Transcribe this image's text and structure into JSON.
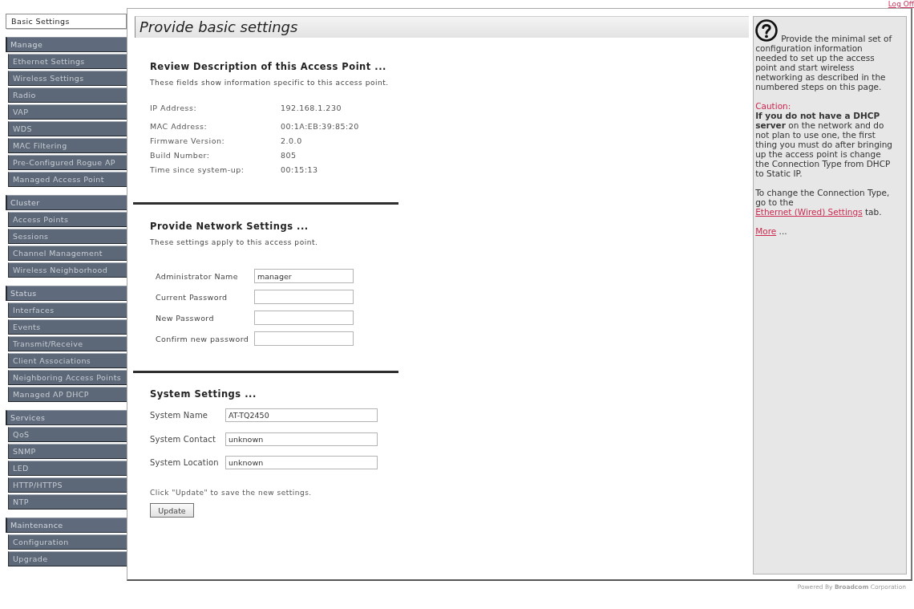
{
  "header": {
    "logoff_link": "Log Off"
  },
  "sidebar": {
    "home": {
      "label": "Basic Settings",
      "selected": true
    },
    "groups": [
      {
        "label": "Manage",
        "items": [
          {
            "label": "Ethernet Settings",
            "selected": false
          },
          {
            "label": "Wireless Settings",
            "selected": false
          },
          {
            "label": "Radio",
            "selected": false
          },
          {
            "label": "VAP",
            "selected": false
          },
          {
            "label": "WDS",
            "selected": false
          },
          {
            "label": "MAC Filtering",
            "selected": false
          },
          {
            "label": "Pre-Configured Rogue AP",
            "selected": false
          },
          {
            "label": "Managed Access Point",
            "selected": false
          }
        ]
      },
      {
        "label": "Cluster",
        "items": [
          {
            "label": "Access Points",
            "selected": false
          },
          {
            "label": "Sessions",
            "selected": false
          },
          {
            "label": "Channel Management",
            "selected": false
          },
          {
            "label": "Wireless Neighborhood",
            "selected": false
          }
        ]
      },
      {
        "label": "Status",
        "items": [
          {
            "label": "Interfaces",
            "selected": false
          },
          {
            "label": "Events",
            "selected": false
          },
          {
            "label": "Transmit/Receive",
            "selected": false
          },
          {
            "label": "Client Associations",
            "selected": false
          },
          {
            "label": "Neighboring Access Points",
            "selected": false
          },
          {
            "label": "Managed AP DHCP",
            "selected": false
          }
        ]
      },
      {
        "label": "Services",
        "items": [
          {
            "label": "QoS",
            "selected": false
          },
          {
            "label": "SNMP",
            "selected": false
          },
          {
            "label": "LED",
            "selected": false
          },
          {
            "label": "HTTP/HTTPS",
            "selected": false
          },
          {
            "label": "NTP",
            "selected": false
          }
        ]
      },
      {
        "label": "Maintenance",
        "items": [
          {
            "label": "Configuration",
            "selected": false
          },
          {
            "label": "Upgrade",
            "selected": false
          }
        ]
      }
    ]
  },
  "page": {
    "title": "Provide basic settings",
    "sections": [
      {
        "kind": "info",
        "heading": "Review Description of this Access Point ...",
        "description": "These fields show information specific to this access point.",
        "rows": [
          {
            "label": "IP Address:",
            "value": "192.168.1.230"
          },
          {
            "label": "MAC Address:",
            "value": "00:1A:EB:39:85:20"
          },
          {
            "label": "Firmware Version:",
            "value": "2.0.0"
          },
          {
            "label": "Build Number:",
            "value": "805"
          },
          {
            "label": "Time since system-up:",
            "value": "00:15:13"
          }
        ]
      },
      {
        "kind": "network",
        "heading": "Provide Network Settings ...",
        "description": "These settings apply to this access point.",
        "fields": [
          {
            "label": "Administrator Name",
            "value": "manager"
          },
          {
            "label": "Current Password"
          },
          {
            "label": "New Password"
          },
          {
            "label": "Confirm new password"
          }
        ]
      },
      {
        "kind": "system",
        "heading": "System Settings ...",
        "fields": [
          {
            "label": "System Name",
            "value": "AT-TQ2450"
          },
          {
            "label": "System Contact",
            "value": "unknown"
          },
          {
            "label": "System Location",
            "value": "unknown"
          }
        ],
        "note": "Click \"Update\" to save the new settings.",
        "button": "Update"
      }
    ]
  },
  "help": {
    "intro": "Provide the minimal set of configuration information needed to set up the access point and start wireless networking as described in the numbered steps on this page.",
    "caution_title": "Caution:",
    "caution_text": "**If you do not have a DHCP server** on the network and do not plan to use one, the first thing you must do after bringing up the access point is change the Connection Type from DHCP to Static IP.",
    "connection": {
      "before": "To change the Connection Type, go to the",
      "link": "Ethernet (Wired) Settings",
      "after": "tab."
    },
    "more": {
      "link": "More",
      "after": "..."
    }
  },
  "footer": {
    "text": "Powered By **Broadcom** Corporation"
  }
}
